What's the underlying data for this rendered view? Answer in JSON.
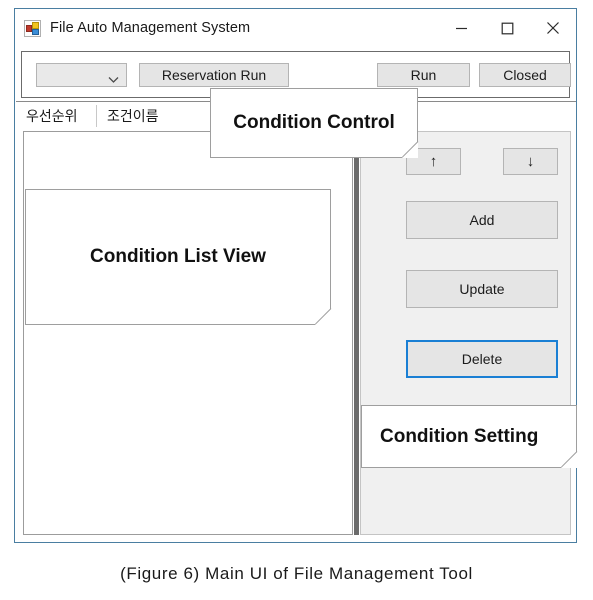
{
  "window": {
    "title": "File Auto Management System",
    "app_icon": "windows-forms-app-icon",
    "controls": {
      "minimize": "minimize-icon",
      "maximize": "maximize-icon",
      "close": "close-icon"
    }
  },
  "toolbar": {
    "combo": {
      "value": "",
      "placeholder": "",
      "chevron": "⌄"
    },
    "reservation_run_label": "Reservation Run",
    "run_label": "Run",
    "closed_label": "Closed"
  },
  "list": {
    "columns": [
      {
        "label": "우선순위"
      },
      {
        "label": "조건이름"
      }
    ],
    "rows": []
  },
  "right_panel": {
    "move_up_label": "↑",
    "move_down_label": "↓",
    "add_label": "Add",
    "update_label": "Update",
    "delete_label": "Delete",
    "delete_focus_color": "#1a7fd4"
  },
  "annotations": {
    "condition_control": "Condition Control",
    "condition_list_view": "Condition List View",
    "condition_setting": "Condition Setting"
  },
  "caption": {
    "text": "(Figure 6) Main UI of File Management Tool"
  },
  "colors": {
    "window_border": "#4a7ea1",
    "panel_border": "#6b6b6b",
    "button_face": "#e5e5e5",
    "right_panel_bg": "#f0f0f0",
    "accent_blue": "#1a7fd4"
  }
}
